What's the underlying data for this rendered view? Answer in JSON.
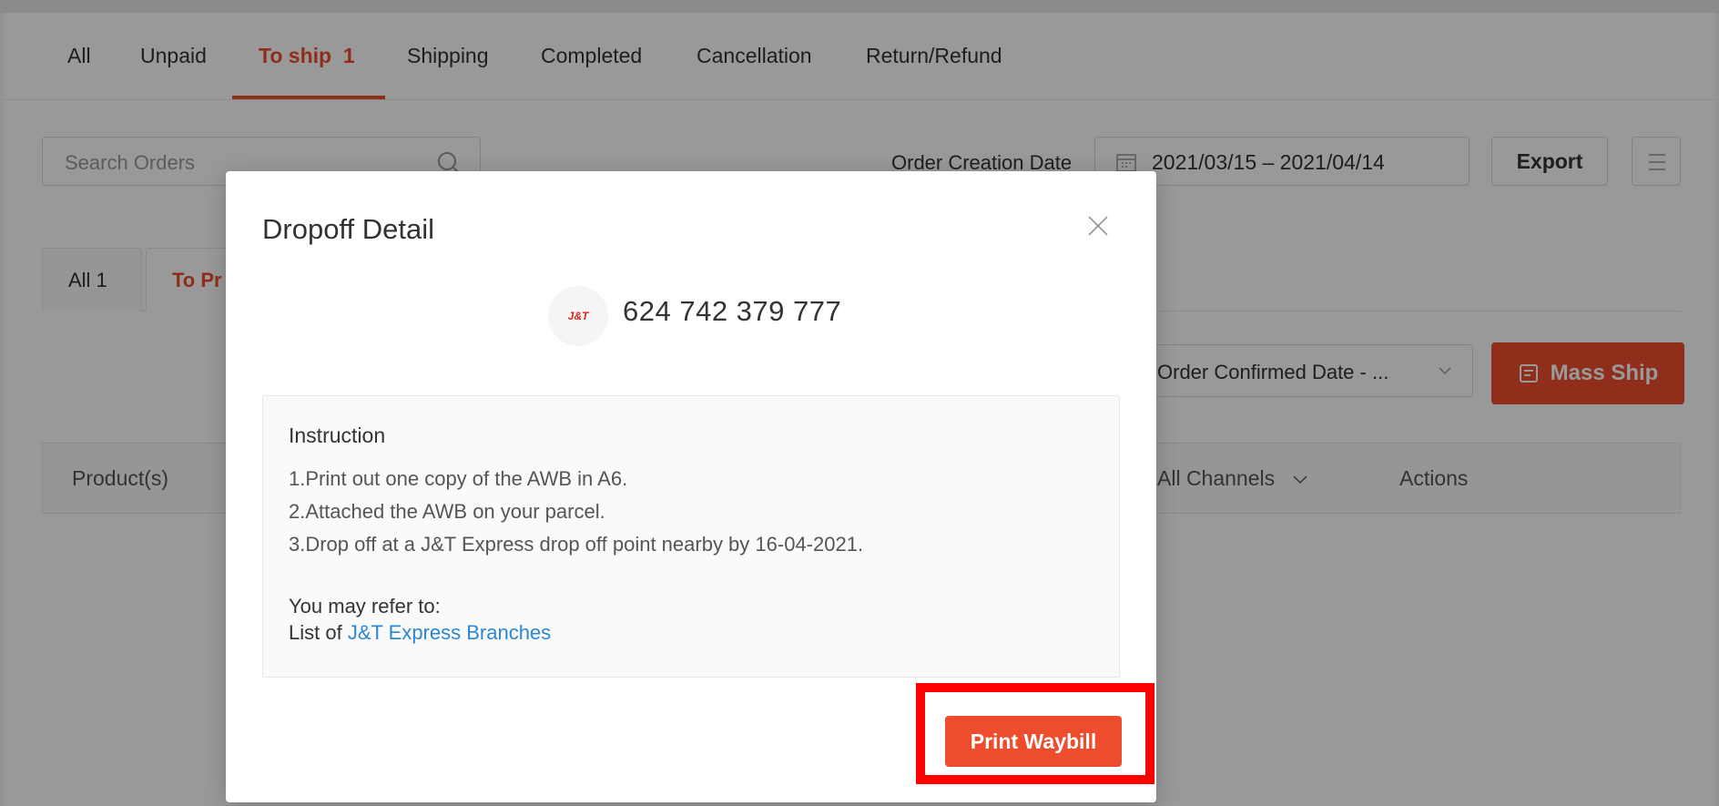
{
  "tabs": [
    {
      "label": "All",
      "active": false
    },
    {
      "label": "Unpaid",
      "active": false
    },
    {
      "label": "To ship  1",
      "active": true
    },
    {
      "label": "Shipping",
      "active": false
    },
    {
      "label": "Completed",
      "active": false
    },
    {
      "label": "Cancellation",
      "active": false
    },
    {
      "label": "Return/Refund",
      "active": false
    }
  ],
  "search": {
    "placeholder": "Search Orders",
    "icon": "search-icon"
  },
  "filters": {
    "order_creation_label": "Order Creation Date",
    "date_range": "2021/03/15 – 2021/04/14",
    "export_label": "Export",
    "confirm_select": "Order Confirmed Date - ..."
  },
  "subtabs": [
    {
      "label": "All 1",
      "active": false
    },
    {
      "label": "To Pr",
      "active": true
    }
  ],
  "mass_ship_label": "Mass Ship",
  "table_headers": {
    "products": "Product(s)",
    "channels": "All Channels",
    "actions": "Actions"
  },
  "modal": {
    "title": "Dropoff Detail",
    "carrier_logo_text": "J&T",
    "tracking_number": "624 742 379 777",
    "instruction_title": "Instruction",
    "instructions": [
      "1.Print out one copy of the AWB in A6.",
      "2.Attached the AWB on your parcel.",
      "3.Drop off at a J&T Express drop off point nearby by 16-04-2021."
    ],
    "refer_text": "You may refer to:",
    "list_prefix": "List of ",
    "branches_link": "J&T Express Branches",
    "print_button": "Print Waybill"
  },
  "colors": {
    "brand": "#ee4d2d",
    "link": "#2b87d3",
    "highlight": "#ff0000"
  }
}
